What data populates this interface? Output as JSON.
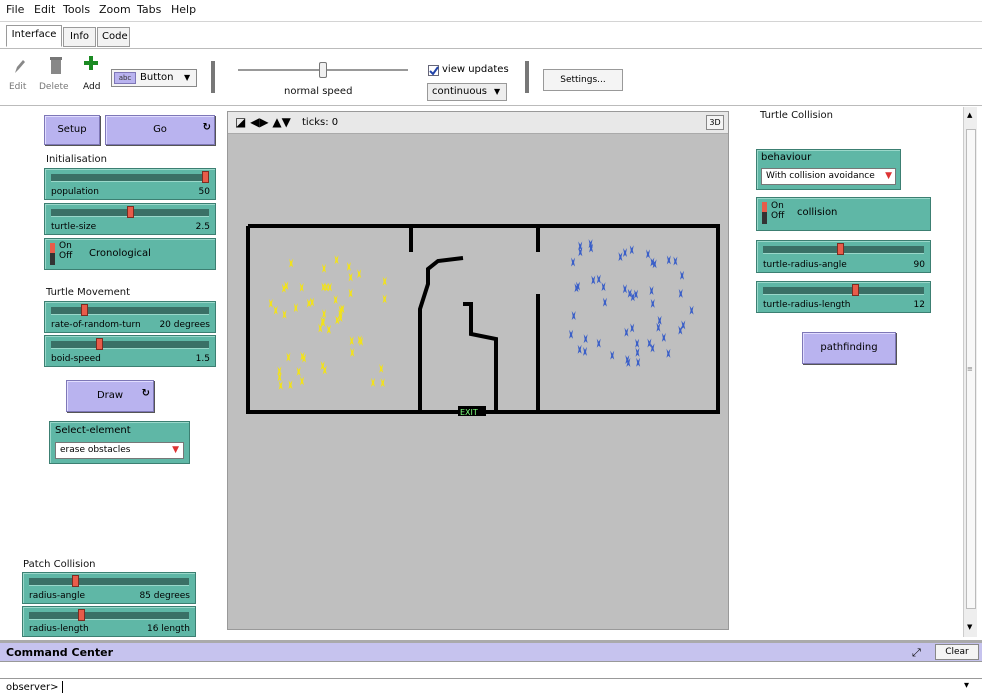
{
  "menu": [
    "File",
    "Edit",
    "Tools",
    "Zoom",
    "Tabs",
    "Help"
  ],
  "tabs": [
    "Interface",
    "Info",
    "Code"
  ],
  "toolbar": {
    "edit": "Edit",
    "delete": "Delete",
    "add": "Add",
    "widget_type": "Button",
    "speed_label": "normal speed",
    "view_updates": "view updates",
    "update_mode": "continuous",
    "settings": "Settings..."
  },
  "left": {
    "setup": "Setup",
    "go": "Go",
    "initialisation": "Initialisation",
    "population": {
      "label": "population",
      "value": "50",
      "fraction": 1.0
    },
    "turtle_size": {
      "label": "turtle-size",
      "value": "2.5",
      "fraction": 0.5
    },
    "switch_on": "On",
    "switch_off": "Off",
    "cronological": "Cronological",
    "turtle_movement": "Turtle Movement",
    "rate_turn": {
      "label": "rate-of-random-turn",
      "value": "20 degrees",
      "fraction": 0.2
    },
    "boid_speed": {
      "label": "boid-speed",
      "value": "1.5",
      "fraction": 0.3
    },
    "draw": "Draw",
    "select_element": "Select-element",
    "select_value": "erase obstacles",
    "patch_collision": "Patch Collision",
    "radius_angle": {
      "label": "radius-angle",
      "value": "85 degrees",
      "fraction": 0.28
    },
    "radius_length": {
      "label": "radius-length",
      "value": "16 length",
      "fraction": 0.32
    }
  },
  "world": {
    "ticks_label": "ticks: 0",
    "three_d": "3D",
    "exit_label": "EXIT"
  },
  "right": {
    "turtle_collision": "Turtle Collision",
    "behaviour": "behaviour",
    "behaviour_value": "With collision avoidance",
    "collision": "collision",
    "turtle_radius_angle": {
      "label": "turtle-radius-angle",
      "value": "90",
      "fraction": 0.48
    },
    "turtle_radius_length": {
      "label": "turtle-radius-length",
      "value": "12",
      "fraction": 0.58
    },
    "pathfinding": "pathfinding"
  },
  "command_center": {
    "title": "Command Center",
    "clear": "Clear",
    "prompt": "observer>"
  },
  "colors": {
    "widget": "#5fb7a6",
    "button": "#b9b3ef",
    "world_bg": "#bfbfbf",
    "agents_yellow": "#f2e21a",
    "agents_blue": "#3a5fc8"
  }
}
